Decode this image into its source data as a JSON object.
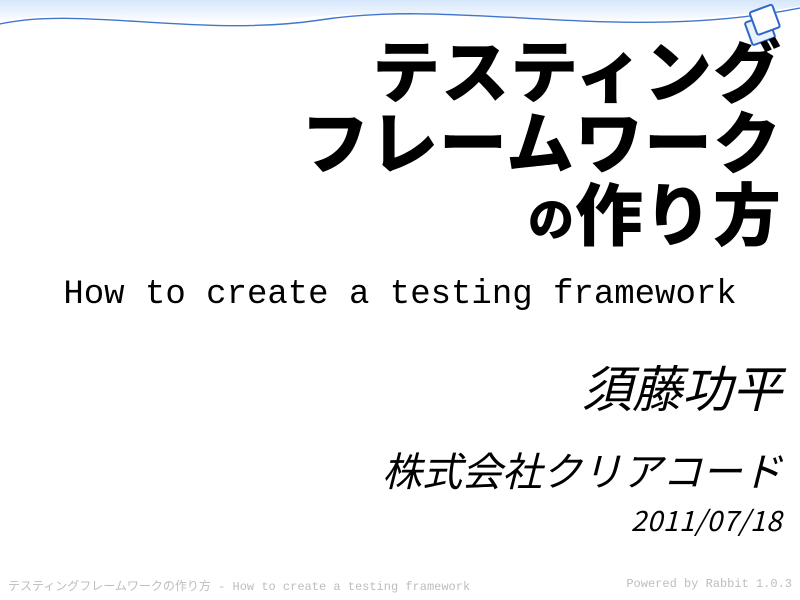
{
  "title": {
    "line1": "テスティング",
    "line2": "フレームワーク",
    "line3_small": "の",
    "line3_rest": "作り方"
  },
  "subtitle_en": "How to create a testing framework",
  "author": "須藤功平",
  "company": "株式会社クリアコード",
  "date": "2011/07/18",
  "footer": {
    "left": "テスティングフレームワークの作り方 - How to create a testing framework",
    "right": "Powered by Rabbit 1.0.3"
  },
  "decor": {
    "stroke": "#2f67c9",
    "fill_light": "#e9f1fc"
  }
}
